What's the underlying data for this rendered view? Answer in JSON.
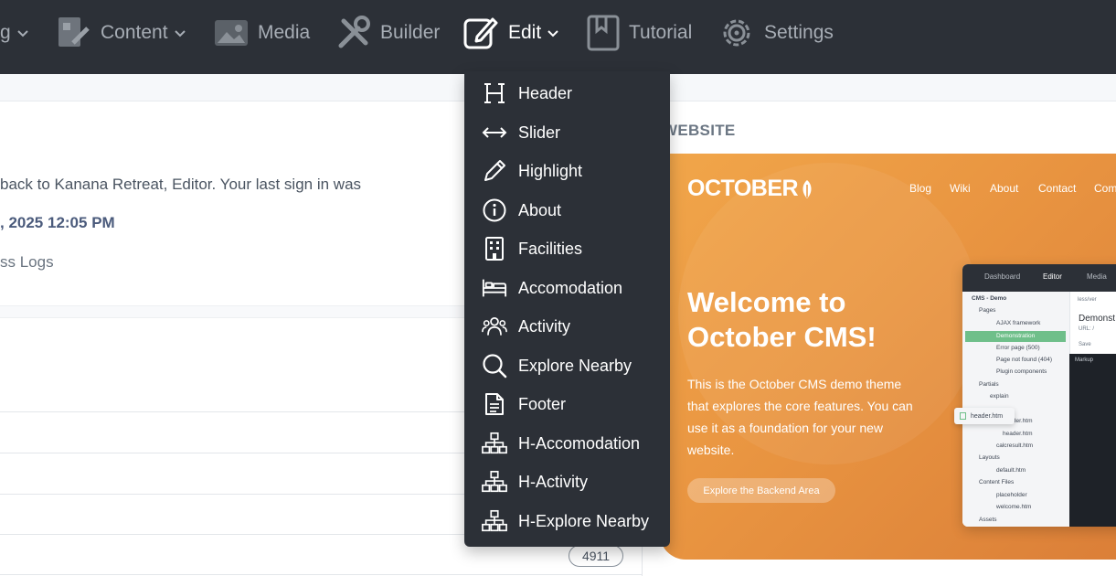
{
  "nav": {
    "items": [
      {
        "label": "g",
        "icon": "chevron-down-icon",
        "has_chevron": true
      },
      {
        "label": "Content",
        "icon": "content-icon",
        "has_chevron": true
      },
      {
        "label": "Media",
        "icon": "media-icon",
        "has_chevron": false
      },
      {
        "label": "Builder",
        "icon": "builder-icon",
        "has_chevron": false
      },
      {
        "label": "Edit",
        "icon": "edit-icon",
        "has_chevron": true,
        "active": true
      },
      {
        "label": "Tutorial",
        "icon": "bookmark-icon",
        "has_chevron": false
      },
      {
        "label": "Settings",
        "icon": "gear-icon",
        "has_chevron": false
      }
    ]
  },
  "dashboard": {
    "welcome": "back to Kanana Retreat, Editor. Your last sign in was",
    "last_sign_in": ", 2025 12:05 PM",
    "access_logs": "ss Logs",
    "count_badge": "4911",
    "website_label": "WEBSITE"
  },
  "dropdown": {
    "items": [
      {
        "label": "Header",
        "icon": "heading-icon"
      },
      {
        "label": "Slider",
        "icon": "arrows-horizontal-icon"
      },
      {
        "label": "Highlight",
        "icon": "pencil-icon"
      },
      {
        "label": "About",
        "icon": "info-icon"
      },
      {
        "label": "Facilities",
        "icon": "building-icon"
      },
      {
        "label": "Accomodation",
        "icon": "bed-icon"
      },
      {
        "label": "Activity",
        "icon": "users-icon"
      },
      {
        "label": "Explore Nearby",
        "icon": "search-icon"
      },
      {
        "label": "Footer",
        "icon": "document-icon"
      },
      {
        "label": "H-Accomodation",
        "icon": "sitemap-icon"
      },
      {
        "label": "H-Activity",
        "icon": "sitemap-icon"
      },
      {
        "label": "H-Explore Nearby",
        "icon": "sitemap-icon"
      }
    ]
  },
  "preview": {
    "brand": "OCTOBER",
    "nav": [
      "Blog",
      "Wiki",
      "About",
      "Contact",
      "Com"
    ],
    "title": "Welcome to October CMS!",
    "description": "This is the October CMS demo theme that explores the core features. You can use it as a foundation for your new website.",
    "button": "Explore the Backend Area",
    "mini": {
      "top_nav": [
        "Dashboard",
        "Editor",
        "Media"
      ],
      "tree": [
        "CMS - Demo",
        "Pages",
        "AJAX framework",
        "Demonstration",
        "Error page (500)",
        "Page not found (404)",
        "Plugin components",
        "Partials",
        "explain",
        "header.htm",
        "header.htm",
        "calcresult.htm",
        "Layouts",
        "default.htm",
        "Content Files",
        "placeholder",
        "welcome.htm",
        "Assets"
      ],
      "page_title": "Demonst",
      "url": "URL: /",
      "tab": "less/ver",
      "save": "Save",
      "markup": "Markup",
      "floating_file": "header.htm"
    }
  },
  "colors": {
    "nav_bg": "#2c3037",
    "nav_text": "#a7adb5",
    "accent_orange": "#e99541"
  }
}
